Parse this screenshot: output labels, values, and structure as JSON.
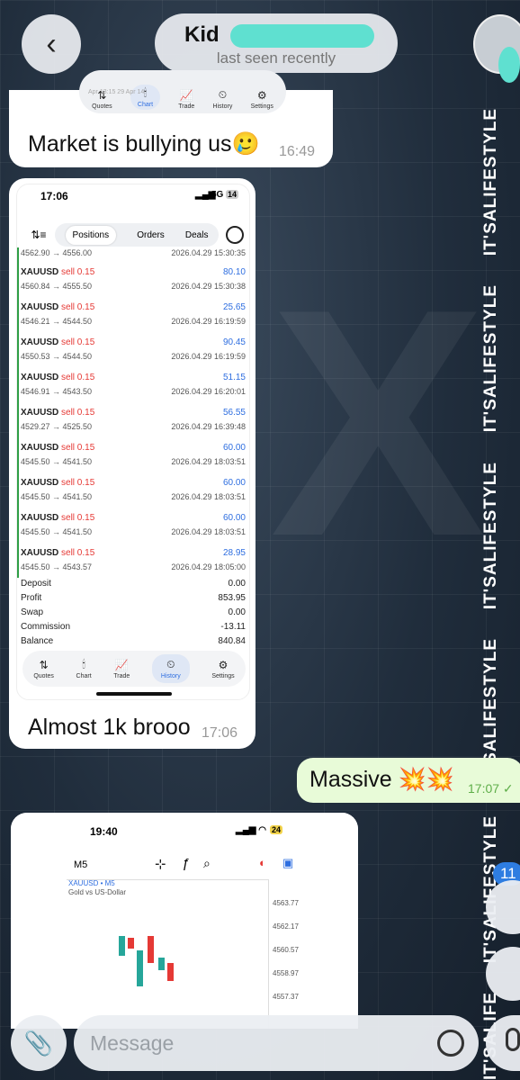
{
  "header": {
    "back_icon": "chevron-left-icon",
    "name": "Kid",
    "status": "last seen recently"
  },
  "side_text": [
    "IT'SALIFESTYLE",
    "IT'SALIFESTYLE",
    "IT'SALIFESTYLE",
    "IT'SALIFESTYLE",
    "IT'SALIFESTYLE",
    "IT'SALIFE"
  ],
  "msg1": {
    "dates": "Apr 13:15      29 Apr 14:",
    "nav": [
      "Quotes",
      "Chart",
      "Trade",
      "History",
      "Settings"
    ],
    "text": "Market is bullying us🥲",
    "time": "16:49"
  },
  "msg2": {
    "statusbar": {
      "time": "17:06",
      "net": "5G",
      "battery": "14"
    },
    "tabs": [
      "Positions",
      "Orders",
      "Deals"
    ],
    "first_row": {
      "prices": "4562.90 → 4556.00",
      "date": "2026.04.29 15:30:35"
    },
    "deals": [
      {
        "symbol": "XAUUSD",
        "side": "sell 0.15",
        "prices": "4560.84 → 4555.50",
        "profit": "80.10",
        "date": "2026.04.29 15:30:38"
      },
      {
        "symbol": "XAUUSD",
        "side": "sell 0.15",
        "prices": "4546.21 → 4544.50",
        "profit": "25.65",
        "date": "2026.04.29 16:19:59"
      },
      {
        "symbol": "XAUUSD",
        "side": "sell 0.15",
        "prices": "4550.53 → 4544.50",
        "profit": "90.45",
        "date": "2026.04.29 16:19:59"
      },
      {
        "symbol": "XAUUSD",
        "side": "sell 0.15",
        "prices": "4546.91 → 4543.50",
        "profit": "51.15",
        "date": "2026.04.29 16:20:01"
      },
      {
        "symbol": "XAUUSD",
        "side": "sell 0.15",
        "prices": "4529.27 → 4525.50",
        "profit": "56.55",
        "date": "2026.04.29 16:39:48"
      },
      {
        "symbol": "XAUUSD",
        "side": "sell 0.15",
        "prices": "4545.50 → 4541.50",
        "profit": "60.00",
        "date": "2026.04.29 18:03:51"
      },
      {
        "symbol": "XAUUSD",
        "side": "sell 0.15",
        "prices": "4545.50 → 4541.50",
        "profit": "60.00",
        "date": "2026.04.29 18:03:51"
      },
      {
        "symbol": "XAUUSD",
        "side": "sell 0.15",
        "prices": "4545.50 → 4541.50",
        "profit": "60.00",
        "date": "2026.04.29 18:03:51"
      },
      {
        "symbol": "XAUUSD",
        "side": "sell 0.15",
        "prices": "4545.50 → 4543.57",
        "profit": "28.95",
        "date": "2026.04.29 18:05:00"
      }
    ],
    "summary": [
      {
        "label": "Deposit",
        "value": "0.00"
      },
      {
        "label": "Profit",
        "value": "853.95"
      },
      {
        "label": "Swap",
        "value": "0.00"
      },
      {
        "label": "Commission",
        "value": "-13.11"
      },
      {
        "label": "Balance",
        "value": "840.84"
      }
    ],
    "nav": [
      "Quotes",
      "Chart",
      "Trade",
      "History",
      "Settings"
    ],
    "text": "Almost 1k brooo",
    "time": "17:06"
  },
  "msg3": {
    "text": "Massive 💥💥",
    "time": "17:07 ✓"
  },
  "msg4": {
    "statusbar": {
      "time": "19:40",
      "battery": "24"
    },
    "timeframe": "M5",
    "symbol": "XAUUSD • M5",
    "desc": "Gold vs US-Dollar",
    "ticks": [
      "4563.77",
      "4562.17",
      "4560.57",
      "4558.97",
      "4557.37"
    ]
  },
  "badge": "11",
  "composer": {
    "placeholder": "Message"
  }
}
